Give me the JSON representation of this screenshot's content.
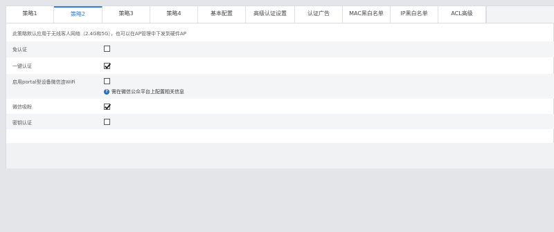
{
  "tabs": [
    {
      "label": "策略1",
      "active": false
    },
    {
      "label": "策略2",
      "active": true
    },
    {
      "label": "策略3",
      "active": false
    },
    {
      "label": "策略4",
      "active": false
    },
    {
      "label": "基本配置",
      "active": false
    },
    {
      "label": "高级认证设置",
      "active": false
    },
    {
      "label": "认证广告",
      "active": false
    },
    {
      "label": "MAC黑白名单",
      "active": false
    },
    {
      "label": "IP黑白名单",
      "active": false
    },
    {
      "label": "ACL高级",
      "active": false
    }
  ],
  "description": "此策略默认应用于无线客人网络（2.4G和5G），也可以在AP管理中下发到硬件AP",
  "settings": [
    {
      "label": "免认证",
      "checked": false
    },
    {
      "label": "一键认证",
      "checked": true
    },
    {
      "label": "启用portal型设备微信连WiFi",
      "checked": false,
      "hint": "需在微信公众平台上配置相关信息"
    },
    {
      "label": "微信吸粉",
      "checked": true
    },
    {
      "label": "密钥认证",
      "checked": false
    }
  ],
  "colors": {
    "accent": "#2f7fd8",
    "hint_icon": "#2f6fb5"
  },
  "icons": {
    "hint": "question-circle-icon",
    "check": "checkmark-icon"
  }
}
